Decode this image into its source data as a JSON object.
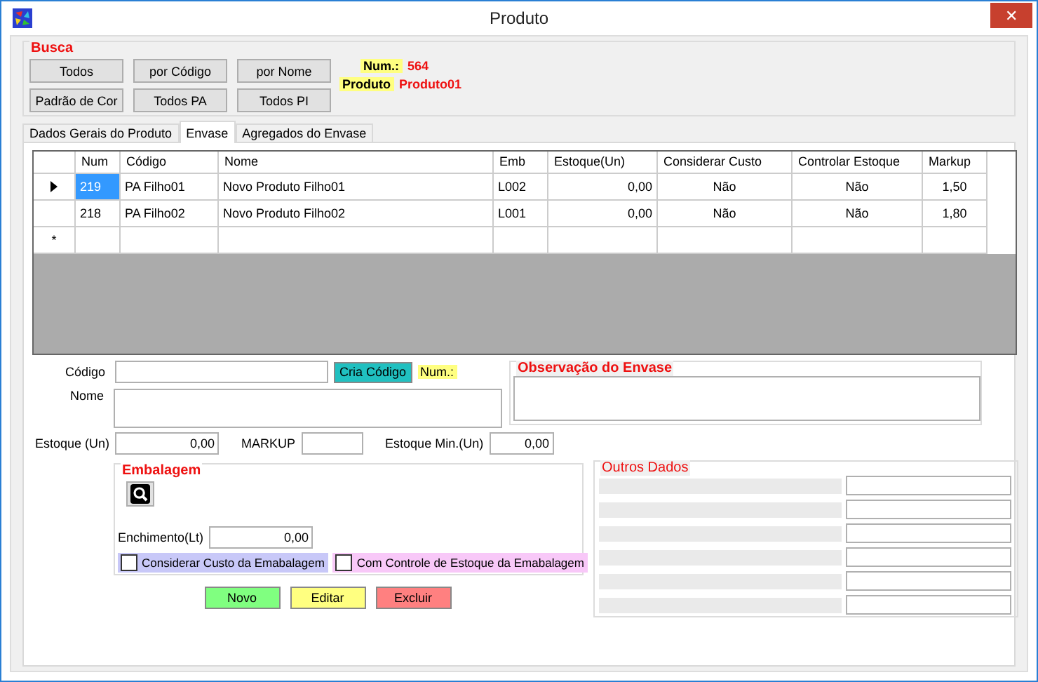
{
  "window": {
    "title": "Produto",
    "close": "✕"
  },
  "busca": {
    "title": "Busca",
    "buttons": [
      "Todos",
      "por Código",
      "por Nome",
      "Padrão de Cor",
      "Todos PA",
      "Todos PI"
    ],
    "num_label": "Num.:",
    "num_value": "564",
    "produto_label": "Produto",
    "produto_value": "Produto01"
  },
  "tabs": [
    {
      "label": "Dados Gerais do Produto",
      "selected": false
    },
    {
      "label": "Envase",
      "selected": true
    },
    {
      "label": "Agregados do Envase",
      "selected": false
    }
  ],
  "table": {
    "columns": [
      "Num",
      "Código",
      "Nome",
      "Emb",
      "Estoque(Un)",
      "Considerar Custo",
      "Controlar Estoque",
      "Markup"
    ],
    "rows": [
      {
        "selected": true,
        "cells": [
          "219",
          "PA Filho01",
          "Novo Produto Filho01",
          "L002",
          "0,00",
          "Não",
          "Não",
          "1,50"
        ]
      },
      {
        "selected": false,
        "cells": [
          "218",
          "PA Filho02",
          "Novo Produto Filho02",
          "L001",
          "0,00",
          "Não",
          "Não",
          "1,80"
        ]
      }
    ],
    "new_row_marker": "*"
  },
  "form": {
    "codigo_label": "Código",
    "cria_codigo": "Cria Código",
    "num_label": "Num.:",
    "nome_label": "Nome",
    "observacao_title": "Observação do Envase",
    "estoque_label": "Estoque (Un)",
    "estoque_value": "0,00",
    "markup_label": "MARKUP",
    "estoque_min_label": "Estoque Min.(Un)",
    "estoque_min_value": "0,00"
  },
  "embalagem": {
    "title": "Embalagem",
    "enchimento_label": "Enchimento(Lt)",
    "enchimento_value": "0,00",
    "checkboxes": [
      {
        "label": "Considerar Custo da Emabalagem",
        "checked": false,
        "color": "#c8c8f8"
      },
      {
        "label": "Com Controle de Estoque da Emabalagem",
        "checked": false,
        "color": "#f8c8f8"
      }
    ]
  },
  "actions": [
    {
      "label": "Novo",
      "color": "#80ff80"
    },
    {
      "label": "Editar",
      "color": "#ffff80"
    },
    {
      "label": "Excluir",
      "color": "#ff8080"
    }
  ],
  "outros_dados": {
    "title": "Outros Dados"
  }
}
